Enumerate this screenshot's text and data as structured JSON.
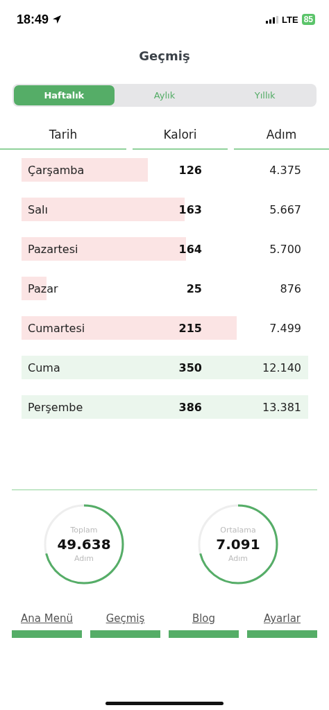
{
  "status_bar": {
    "time": "18:49",
    "network": "LTE",
    "battery": "85"
  },
  "title": "Geçmiş",
  "tabs": [
    {
      "label": "Haftalık",
      "selected": true
    },
    {
      "label": "Aylık",
      "selected": false
    },
    {
      "label": "Yıllık",
      "selected": false
    }
  ],
  "table": {
    "columns": [
      "Tarih",
      "Kalori",
      "Adım"
    ],
    "rows": [
      {
        "day": "Çarşamba",
        "calories": "126",
        "steps": "4.375",
        "color": "#fbe4e4"
      },
      {
        "day": "Salı",
        "calories": "163",
        "steps": "5.667",
        "color": "#fbe4e4"
      },
      {
        "day": "Pazartesi",
        "calories": "164",
        "steps": "5.700",
        "color": "#fbe4e4"
      },
      {
        "day": "Pazar",
        "calories": "25",
        "steps": "876",
        "color": "#fbe4e4"
      },
      {
        "day": "Cumartesi",
        "calories": "215",
        "steps": "7.499",
        "color": "#fbe4e4"
      },
      {
        "day": "Cuma",
        "calories": "350",
        "steps": "12.140",
        "color": "#ebf6ed"
      },
      {
        "day": "Perşembe",
        "calories": "386",
        "steps": "13.381",
        "color": "#ebf6ed"
      }
    ]
  },
  "summary": [
    {
      "caption": "Toplam",
      "value": "49.638",
      "unit": "Adım"
    },
    {
      "caption": "Ortalama",
      "value": "7.091",
      "unit": "Adım"
    }
  ],
  "nav": [
    {
      "label": "Ana Menü"
    },
    {
      "label": "Geçmiş"
    },
    {
      "label": "Blog"
    },
    {
      "label": "Ayarlar"
    }
  ]
}
